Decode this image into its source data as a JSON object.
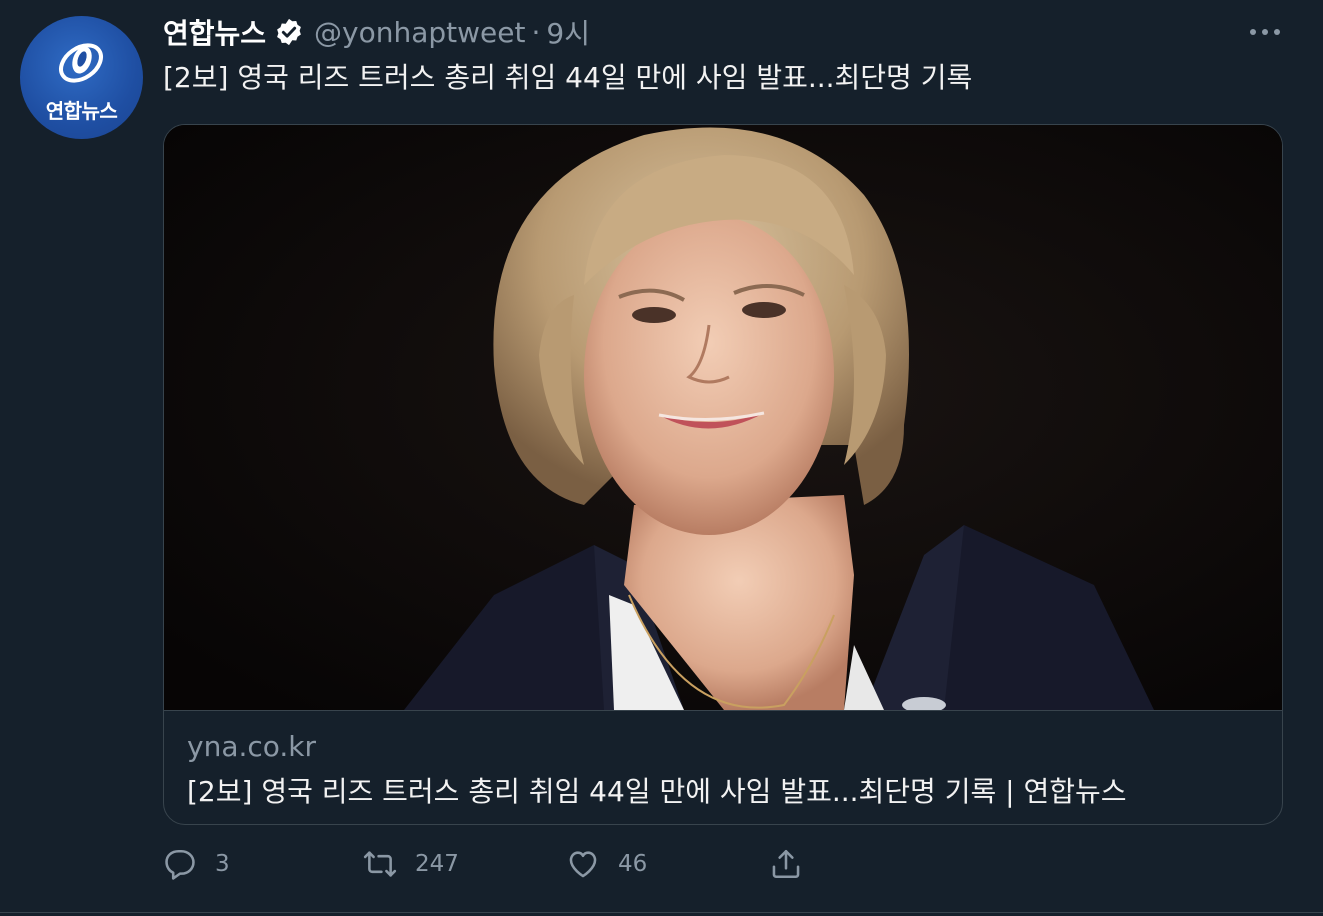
{
  "tweet": {
    "display_name": "연합뉴스",
    "handle": "@yonhaptweet",
    "separator": "·",
    "time": "9시",
    "text": "[2보] 영국 리즈 트러스 총리 취임 44일 만에 사임 발표...최단명 기록",
    "avatar": {
      "logo_text": "연합뉴스",
      "background_color": "#1f4fa3"
    },
    "verified_icon": "verified-badge-icon",
    "more_icon": "more-horizontal-icon"
  },
  "card": {
    "image_icon": "portrait-photo",
    "domain": "yna.co.kr",
    "title": "[2보] 영국 리즈 트러스 총리 취임 44일 만에 사임 발표...최단명 기록 | 연합뉴스"
  },
  "actions": {
    "reply": {
      "icon": "reply-icon",
      "count": "3"
    },
    "retweet": {
      "icon": "retweet-icon",
      "count": "247"
    },
    "like": {
      "icon": "heart-icon",
      "count": "46"
    },
    "share": {
      "icon": "share-icon"
    }
  },
  "colors": {
    "background": "#15202b",
    "secondary_text": "#8b98a5",
    "border": "#38444d"
  }
}
